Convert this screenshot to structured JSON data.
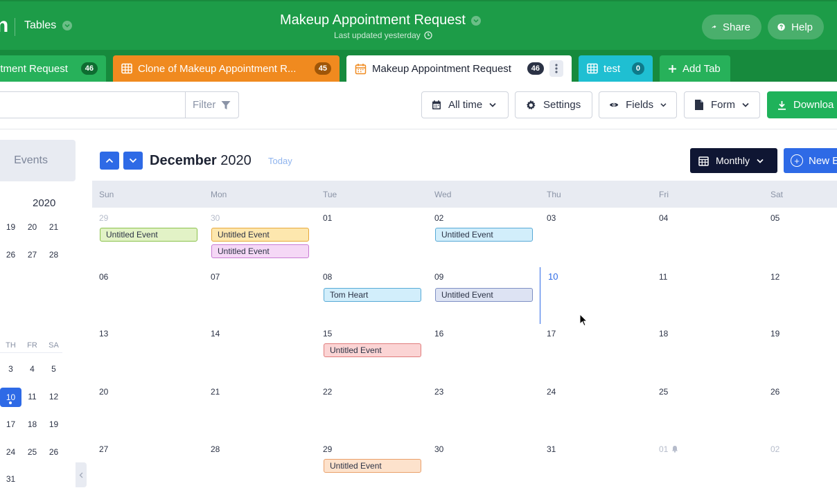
{
  "header": {
    "logo_fragment": "n",
    "tables_label": "Tables",
    "title": "Makeup Appointment Request",
    "last_updated": "Last updated yesterday",
    "share_label": "Share",
    "help_label": "Help",
    "brand_color": "#1d9c48"
  },
  "tabs": [
    {
      "label": "ntment Request",
      "count": "46",
      "color": "#27b15a"
    },
    {
      "label": "Clone of Makeup Appointment R...",
      "count": "45",
      "color": "#f08a1f"
    },
    {
      "label": "Makeup Appointment Request",
      "count": "46",
      "color": "#ffffff",
      "active": true
    },
    {
      "label": "test",
      "count": "0",
      "color": "#1fbfd2"
    }
  ],
  "add_tab_label": "Add Tab",
  "toolbar": {
    "filter_label": "Filter",
    "all_time_label": "All time",
    "settings_label": "Settings",
    "fields_label": "Fields",
    "form_label": "Form",
    "download_label": "Downloa"
  },
  "sidebar": {
    "events_label": "Events",
    "year": "2020",
    "row1": [
      "19",
      "20",
      "21"
    ],
    "row2": [
      "26",
      "27",
      "28"
    ],
    "dow": [
      "TH",
      "FR",
      "SA"
    ],
    "weeks": [
      [
        "3",
        "4",
        "5"
      ],
      [
        "10",
        "11",
        "12"
      ],
      [
        "17",
        "18",
        "19"
      ],
      [
        "24",
        "25",
        "26"
      ],
      [
        "31",
        "",
        ""
      ]
    ],
    "today": "10"
  },
  "calendar": {
    "month": "December",
    "year": "2020",
    "today_label": "Today",
    "view_label": "Monthly",
    "new_event_label": "New E",
    "dow": [
      "Sun",
      "Mon",
      "Tue",
      "Wed",
      "Thu",
      "Fri",
      "Sat"
    ],
    "weeks": [
      [
        "29",
        "30",
        "01",
        "02",
        "03",
        "04",
        "05"
      ],
      [
        "06",
        "07",
        "08",
        "09",
        "10",
        "11",
        "12"
      ],
      [
        "13",
        "14",
        "15",
        "16",
        "17",
        "18",
        "19"
      ],
      [
        "20",
        "21",
        "22",
        "23",
        "24",
        "25",
        "26"
      ],
      [
        "27",
        "28",
        "29",
        "30",
        "31",
        "01",
        "02"
      ]
    ],
    "events": [
      {
        "label": "Untitled Event",
        "week": 0,
        "day": 0,
        "slot": 0,
        "color": "green"
      },
      {
        "label": "Untitled Event",
        "week": 0,
        "day": 1,
        "slot": 0,
        "color": "yellow"
      },
      {
        "label": "Untitled Event",
        "week": 0,
        "day": 1,
        "slot": 1,
        "color": "pink"
      },
      {
        "label": "Untitled Event",
        "week": 0,
        "day": 3,
        "slot": 0,
        "color": "cyan"
      },
      {
        "label": "Tom Heart",
        "week": 1,
        "day": 2,
        "slot": 0,
        "color": "cyan"
      },
      {
        "label": "Untitled Event",
        "week": 1,
        "day": 3,
        "slot": 0,
        "color": "lavender"
      },
      {
        "label": "Untitled Event",
        "week": 2,
        "day": 2,
        "slot": 0,
        "color": "red"
      },
      {
        "label": "Untitled Event",
        "week": 4,
        "day": 2,
        "slot": 0,
        "color": "peach"
      }
    ]
  }
}
